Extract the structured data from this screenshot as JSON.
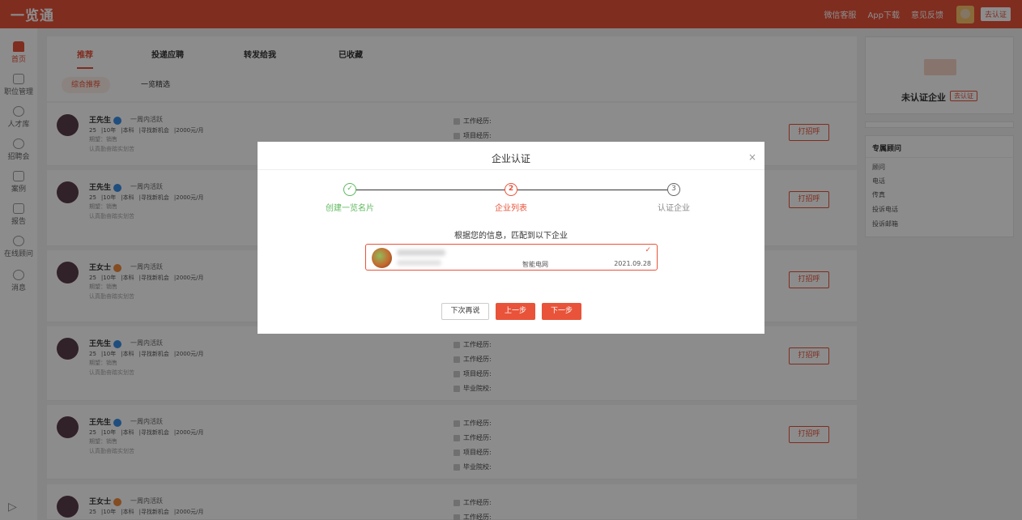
{
  "app": {
    "logo": "一览通"
  },
  "topbar": {
    "links": [
      "微信客服",
      "App下载",
      "意见反馈"
    ],
    "cert_label": "去认证"
  },
  "sidebar": {
    "items": [
      {
        "label": "首页",
        "icon": "home-icon",
        "active": true
      },
      {
        "label": "职位管理",
        "icon": "briefcase-icon"
      },
      {
        "label": "人才库",
        "icon": "person-icon"
      },
      {
        "label": "招聘会",
        "icon": "fair-icon"
      },
      {
        "label": "案例",
        "icon": "book-icon"
      },
      {
        "label": "报告",
        "icon": "report-icon"
      },
      {
        "label": "在线顾问",
        "icon": "consultant-icon"
      },
      {
        "label": "消息",
        "icon": "message-icon"
      }
    ]
  },
  "main": {
    "tabs": [
      "推荐",
      "投递应聘",
      "转发给我",
      "已收藏"
    ],
    "subtabs": [
      "综合推荐",
      "一览精选"
    ],
    "cards": [
      {
        "name": "王先生",
        "gender": "m",
        "active": "一周内活跃",
        "age": "25",
        "exp": "10年",
        "edu": "本科",
        "status": "寻找新机会",
        "salary": "2000元/月",
        "expect": "期望：销售",
        "note": "认真勤奋踏实划苦",
        "right": [
          "工作经历:",
          "项目经历:"
        ]
      },
      {
        "name": "王先生",
        "gender": "m",
        "active": "一周内活跃",
        "age": "25",
        "exp": "10年",
        "edu": "本科",
        "status": "寻找新机会",
        "salary": "2000元/月",
        "expect": "期望：销售",
        "note": "认真勤奋踏实划苦",
        "right": []
      },
      {
        "name": "王女士",
        "gender": "f",
        "active": "一周内活跃",
        "age": "25",
        "exp": "10年",
        "edu": "本科",
        "status": "寻找新机会",
        "salary": "2000元/月",
        "expect": "期望：销售",
        "note": "认真勤奋踏实划苦",
        "right": []
      },
      {
        "name": "王先生",
        "gender": "m",
        "active": "一周内活跃",
        "age": "25",
        "exp": "10年",
        "edu": "本科",
        "status": "寻找新机会",
        "salary": "2000元/月",
        "expect": "期望：销售",
        "note": "认真勤奋踏实划苦",
        "right": [
          "工作经历:",
          "工作经历:",
          "项目经历:",
          "毕业院校:"
        ]
      },
      {
        "name": "王先生",
        "gender": "m",
        "active": "一周内活跃",
        "age": "25",
        "exp": "10年",
        "edu": "本科",
        "status": "寻找新机会",
        "salary": "2000元/月",
        "expect": "期望：销售",
        "note": "认真勤奋踏实划苦",
        "right": [
          "工作经历:",
          "工作经历:",
          "项目经历:",
          "毕业院校:"
        ]
      },
      {
        "name": "王女士",
        "gender": "f",
        "active": "一周内活跃",
        "age": "25",
        "exp": "10年",
        "edu": "本科",
        "status": "寻找新机会",
        "salary": "2000元/月",
        "expect": "",
        "note": "",
        "right": [
          "工作经历:",
          "工作经历:"
        ]
      }
    ],
    "greet_label": "打招呼"
  },
  "right_panel": {
    "company_title": "未认证企业",
    "cert_label": "去认证",
    "advisor_title": "专属顾问",
    "advisor_items": [
      "顾问",
      "电话",
      "传真",
      "投诉电话",
      "投诉邮箱"
    ]
  },
  "modal": {
    "title": "企业认证",
    "steps": [
      {
        "num": "✓",
        "label": "创建一览名片",
        "state": "done"
      },
      {
        "num": "2",
        "label": "企业列表",
        "state": "current"
      },
      {
        "num": "3",
        "label": "认证企业",
        "state": "todo"
      }
    ],
    "match_title": "根据您的信息，匹配到以下企业",
    "company": {
      "industry": "智能电网",
      "date": "2021.09.28",
      "selected_mark": "✓"
    },
    "buttons": {
      "later": "下次再说",
      "prev": "上一步",
      "next": "下一步"
    },
    "close_mark": "×"
  },
  "colors": {
    "brand": "#e8533a",
    "done": "#5cb85c"
  }
}
